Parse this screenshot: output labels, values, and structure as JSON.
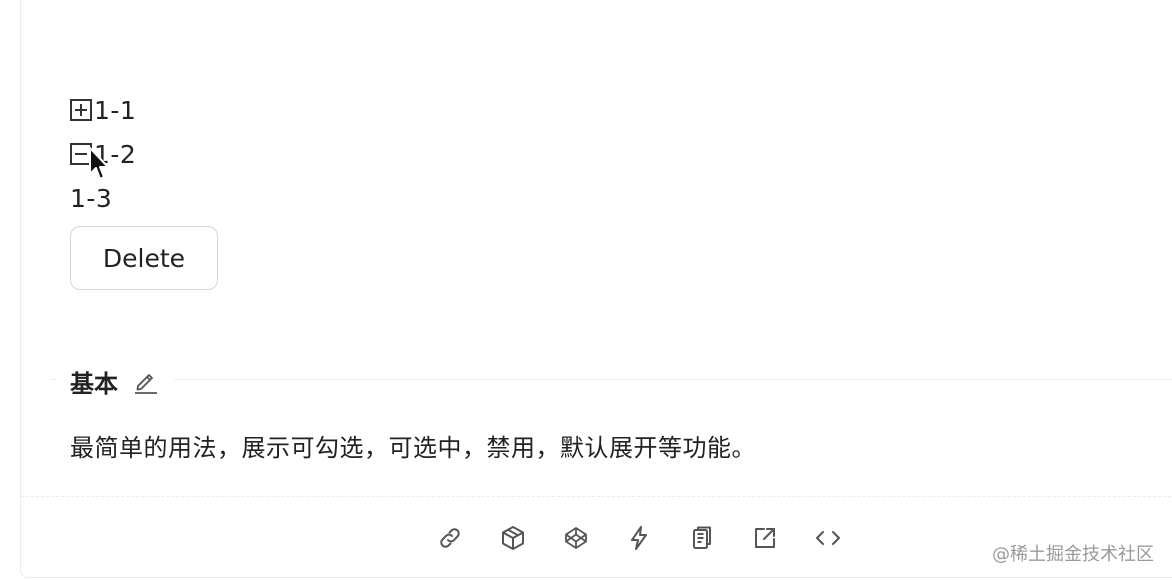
{
  "tree": {
    "nodes": [
      {
        "title": "1-1",
        "switcher": "plus-square-icon"
      },
      {
        "title": "1-2",
        "switcher": "minus-square-icon"
      },
      {
        "title": "1-3",
        "switcher": ""
      }
    ]
  },
  "delete_button": {
    "label": "Delete"
  },
  "section": {
    "title": "基本",
    "description": "最简单的用法，展示可勾选，可选中，禁用，默认展开等功能。"
  },
  "actions": [
    {
      "icon": "link-icon"
    },
    {
      "icon": "codesandbox-icon"
    },
    {
      "icon": "codepen-icon"
    },
    {
      "icon": "stackblitz-icon"
    },
    {
      "icon": "copy-code-icon"
    },
    {
      "icon": "external-link-icon"
    },
    {
      "icon": "show-code-icon"
    }
  ],
  "watermark": "@稀土掘金技术社区",
  "colors": {
    "text": "#222222",
    "icon": "#555555",
    "border": "#ececec",
    "watermark": "#9a9a9a"
  }
}
